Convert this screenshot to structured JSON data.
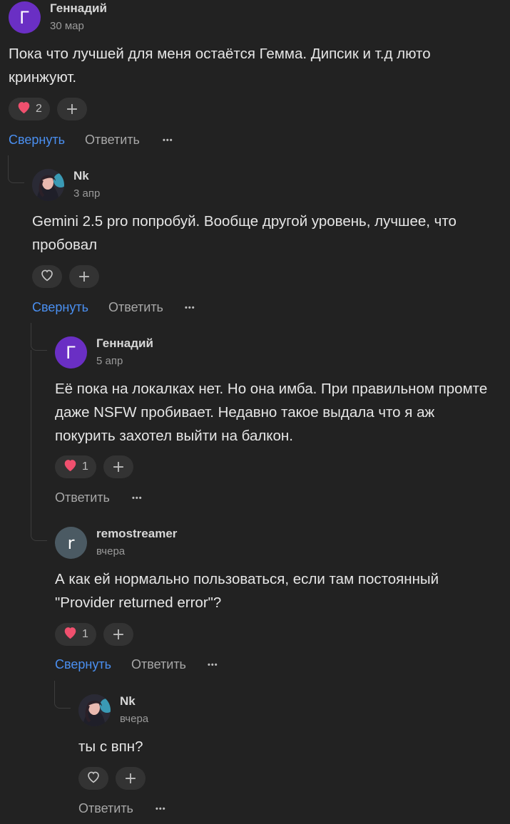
{
  "colors": {
    "accent": "#4a8ff0",
    "heart": "#f0506e",
    "background": "#222222"
  },
  "comments": [
    {
      "avatar_letter": "Г",
      "author": "Геннадий",
      "date": "30 мар",
      "text": "Пока что лучшей для меня остаётся Гемма. Дипсик и т.д люто кринжуют.",
      "likes": "2",
      "liked": true,
      "collapse_label": "Свернуть",
      "reply_label": "Ответить"
    },
    {
      "avatar_letter": "",
      "author": "Nk",
      "date": "3 апр",
      "text": "Gemini 2.5 pro попробуй. Вообще другой уровень, лучшее, что пробовал",
      "likes": "",
      "liked": false,
      "collapse_label": "Свернуть",
      "reply_label": "Ответить"
    },
    {
      "avatar_letter": "Г",
      "author": "Геннадий",
      "date": "5 апр",
      "text": "Её пока на локалках нет. Но она имба. При правильном промте даже NSFW пробивает. Недавно такое выдала что я аж покурить захотел выйти на балкон.",
      "likes": "1",
      "liked": true,
      "collapse_label": "",
      "reply_label": "Ответить"
    },
    {
      "avatar_letter": "r",
      "author": "remostreamer",
      "date": "вчера",
      "text": "А как ей нормально пользоваться, если там постоянный \"Provider returned error\"?",
      "likes": "1",
      "liked": true,
      "collapse_label": "Свернуть",
      "reply_label": "Ответить"
    },
    {
      "avatar_letter": "",
      "author": "Nk",
      "date": "вчера",
      "text": "ты с впн?",
      "likes": "",
      "liked": false,
      "collapse_label": "",
      "reply_label": "Ответить"
    }
  ],
  "icons": {
    "heart": "heart-icon",
    "heart_outline": "heart-outline-icon",
    "add_reaction": "plus-icon",
    "more": "more-icon"
  },
  "more_glyph": "•••",
  "plus_glyph": "+"
}
